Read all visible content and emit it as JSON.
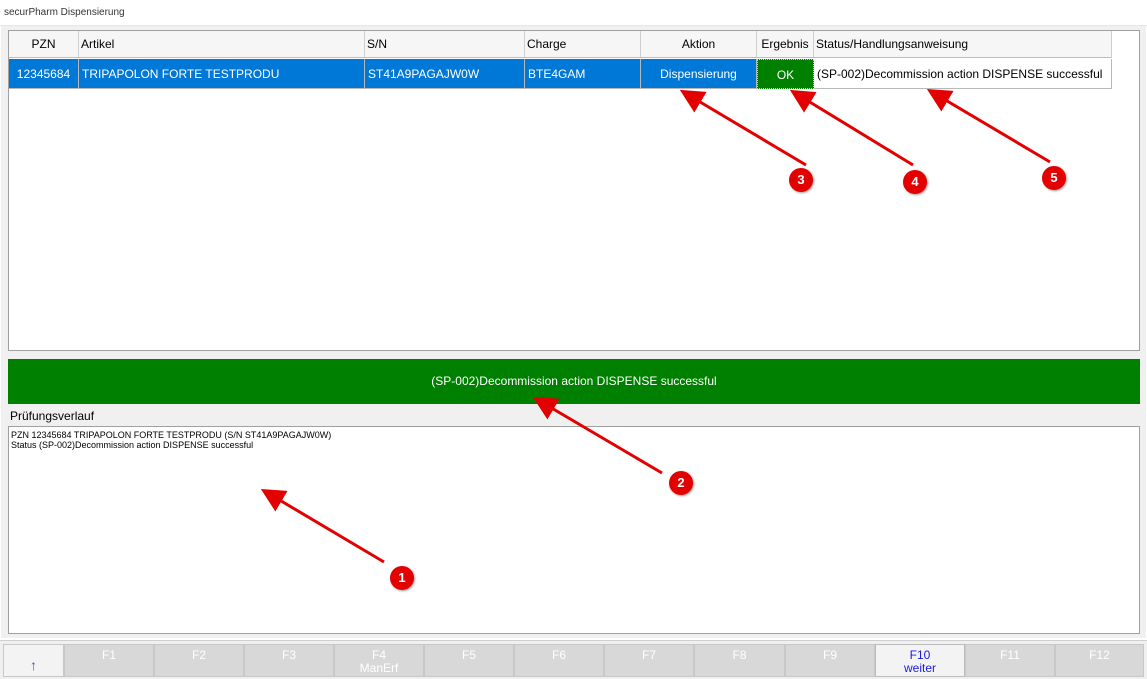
{
  "window": {
    "title": "securPharm Dispensierung"
  },
  "grid": {
    "columns": [
      "PZN",
      "Artikel",
      "S/N",
      "Charge",
      "Aktion",
      "Ergebnis",
      "Status/Handlungsanweisung"
    ],
    "rows": [
      {
        "pzn": "12345684",
        "artikel": "TRIPAPOLON FORTE TESTPRODU",
        "sn": "ST41A9PAGAJW0W",
        "charge": "BTE4GAM",
        "aktion": "Dispensierung",
        "ergebnis": "OK",
        "status": "(SP-002)Decommission action DISPENSE successful"
      }
    ]
  },
  "status_bar": {
    "text": "(SP-002)Decommission action DISPENSE successful"
  },
  "history": {
    "label": "Prüfungsverlauf",
    "lines": [
      "PZN 12345684 TRIPAPOLON FORTE TESTPRODU (S/N ST41A9PAGAJW0W)",
      "Status (SP-002)Decommission action DISPENSE successful"
    ]
  },
  "fkeys": [
    {
      "key": "↑",
      "sub": ""
    },
    {
      "key": "F1",
      "sub": ""
    },
    {
      "key": "F2",
      "sub": ""
    },
    {
      "key": "F3",
      "sub": ""
    },
    {
      "key": "F4",
      "sub": "ManErf"
    },
    {
      "key": "F5",
      "sub": ""
    },
    {
      "key": "F6",
      "sub": ""
    },
    {
      "key": "F7",
      "sub": ""
    },
    {
      "key": "F8",
      "sub": ""
    },
    {
      "key": "F9",
      "sub": ""
    },
    {
      "key": "F10",
      "sub": "weiter"
    },
    {
      "key": "F11",
      "sub": ""
    },
    {
      "key": "F12",
      "sub": ""
    }
  ],
  "annotations": [
    "1",
    "2",
    "3",
    "4",
    "5"
  ],
  "colors": {
    "selection": "#0078d7",
    "ok_green": "#008000",
    "annotation_red": "#e30000"
  }
}
